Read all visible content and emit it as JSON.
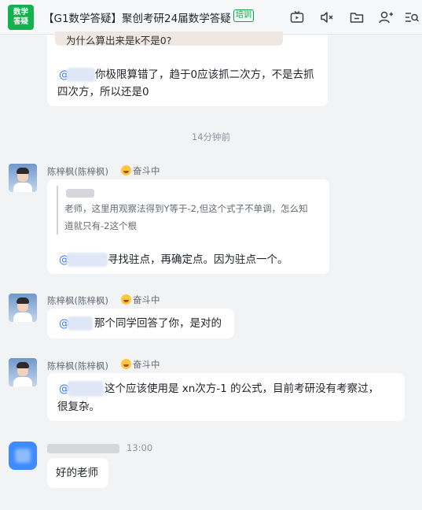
{
  "header": {
    "group_avatar_text": "数学\n答疑",
    "group_avatar_line1": "数学",
    "group_avatar_line2": "答疑",
    "title": "【G1数学答疑】聚创考研24届数学答疑",
    "tag": "培训",
    "icons": [
      "tv-icon",
      "mute-icon",
      "folder-icon",
      "add-member-icon",
      "search-list-icon"
    ]
  },
  "messages": {
    "top_partial": {
      "quoted_text": "为什么算出来是k不是0?",
      "mention": "@",
      "line1": "你极限算错了，趋于0应该抓二次方，不是去抓",
      "line2": "四次方，所以还是0"
    },
    "timestamp": "14分钟前",
    "msg1": {
      "sender": "陈梓枫(陈梓枫)",
      "status": "奋斗中",
      "quote_line1": "老师，这里用观察法得到Y等于-2,但这个式子不单调，怎么知",
      "quote_line2": "道就只有-2这个根",
      "mention": "@",
      "text": "寻找驻点，再确定点。因为驻点一个。"
    },
    "msg2": {
      "sender": "陈梓枫(陈梓枫)",
      "status": "奋斗中",
      "mention": "@",
      "text": "那个同学回答了你，是对的"
    },
    "msg3": {
      "sender": "陈梓枫(陈梓枫)",
      "status": "奋斗中",
      "mention": "@",
      "line1": "这个应该使用是 xn次方-1 的公式，目前考研没有考察过，",
      "line2": "很复杂。"
    },
    "msg4": {
      "time": "13:00",
      "text": "好的老师"
    }
  }
}
